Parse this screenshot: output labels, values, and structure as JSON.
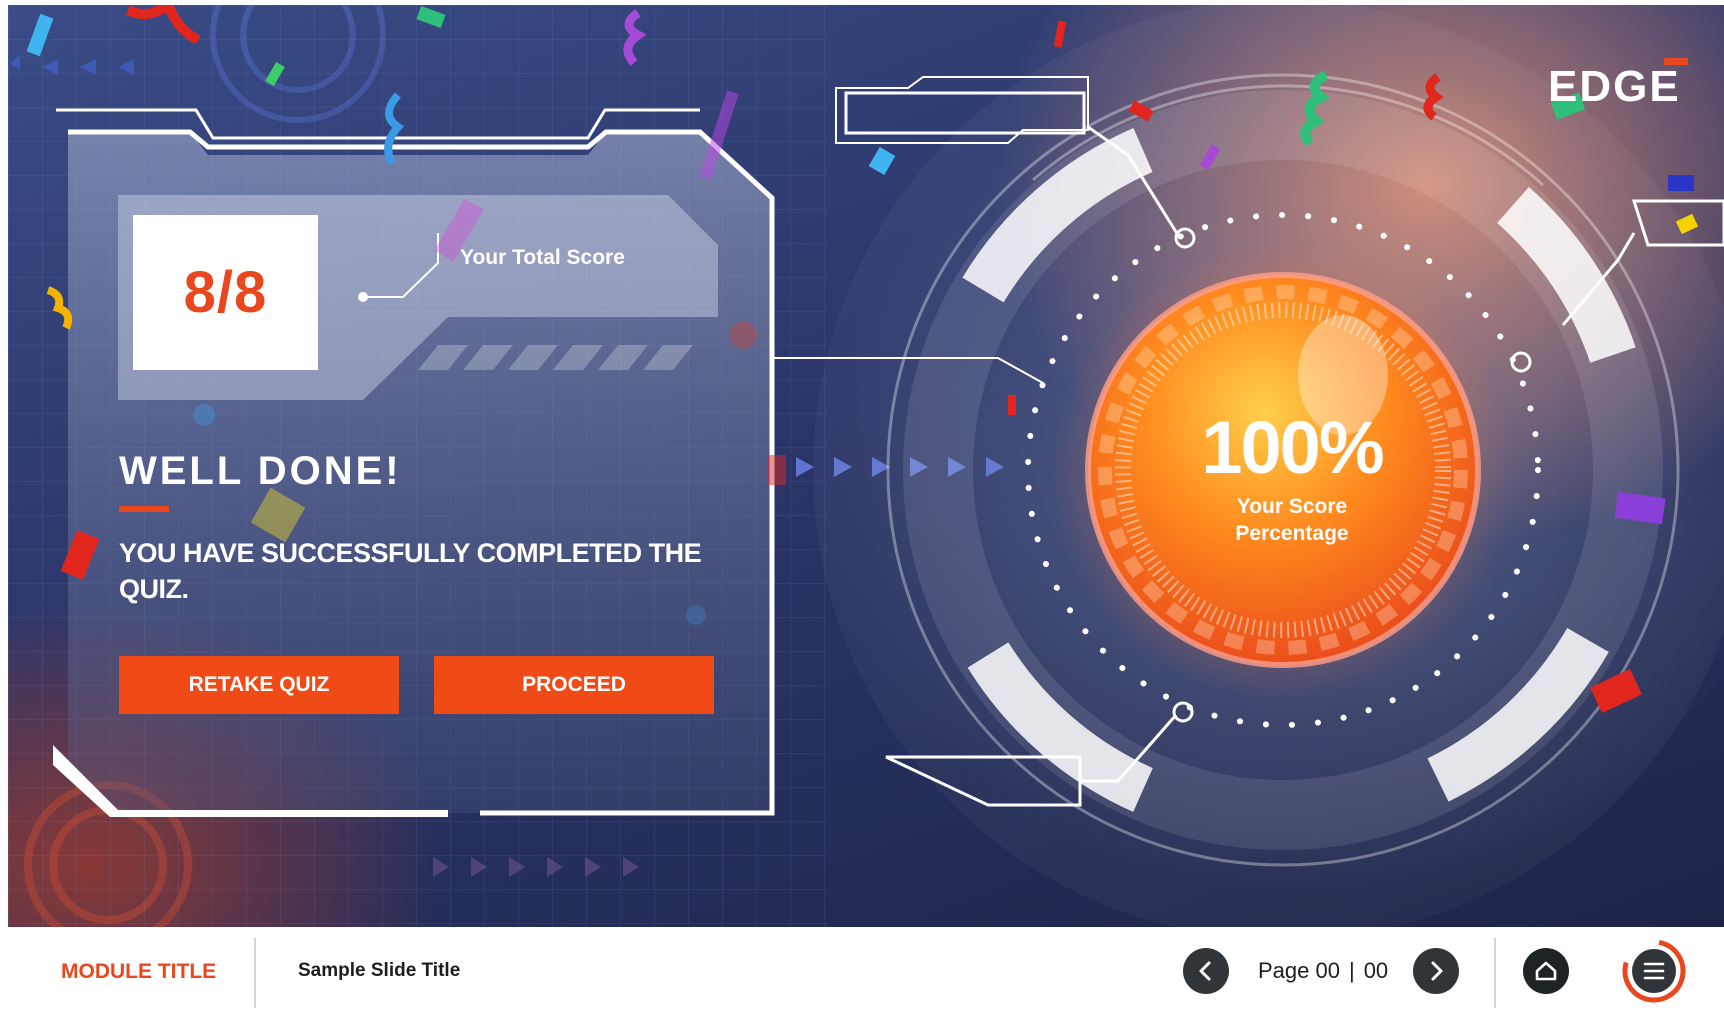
{
  "brand": {
    "logo": "EDGE",
    "accent": "#e9481e",
    "button_color": "#f04b16"
  },
  "result": {
    "score": "8/8",
    "score_label": "Your Total Score",
    "heading": "WELL DONE!",
    "message": "YOU HAVE SUCCESSFULLY COMPLETED THE QUIZ."
  },
  "actions": {
    "retake_label": "RETAKE QUIZ",
    "proceed_label": "PROCEED"
  },
  "gauge": {
    "percent": "100%",
    "label_line1": "Your Score",
    "label_line2": "Percentage",
    "level": 1.0
  },
  "footer": {
    "module_title": "MODULE TITLE",
    "slide_title": "Sample Slide Title",
    "page_label": "Page 00",
    "page_separator": "|",
    "page_total": "00"
  },
  "icons": {
    "prev": "chevron-left-icon",
    "next": "chevron-right-icon",
    "home": "home-icon",
    "menu": "hamburger-menu-icon"
  }
}
